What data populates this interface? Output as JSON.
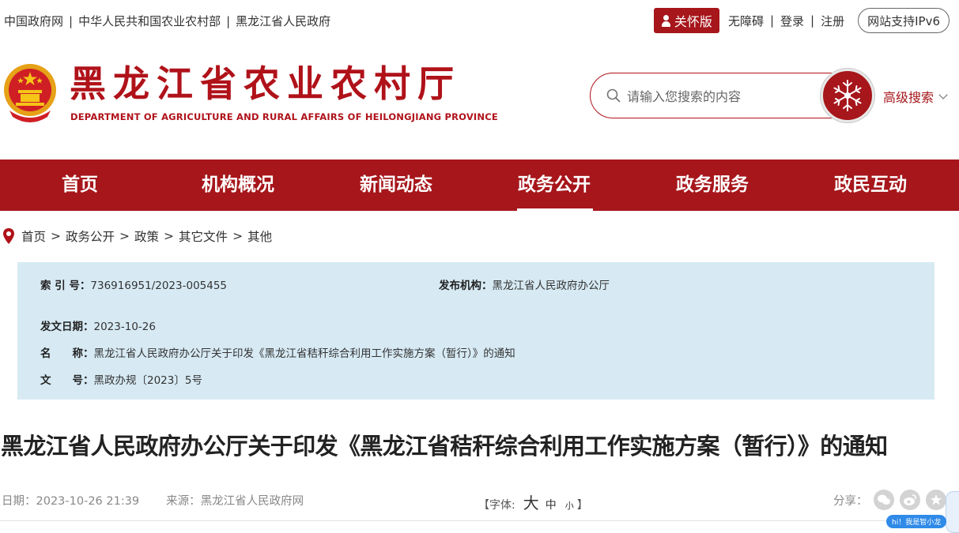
{
  "top_links": [
    "中国政府网",
    "中华人民共和国农业农村部",
    "黑龙江省人民政府"
  ],
  "top_separator": "|",
  "care_mode": "关怀版",
  "accessibility": "无障碍",
  "login": "登录",
  "register": "注册",
  "ipv6": "网站支持IPv6",
  "site": {
    "title": "黑龙江省农业农村厅",
    "subtitle_en": "DEPARTMENT OF AGRICULTURE AND RURAL AFFAIRS OF HEILONGJIANG PROVINCE"
  },
  "search": {
    "placeholder": "请输入您搜索的内容",
    "advanced": "高级搜索"
  },
  "nav": [
    "首页",
    "机构概况",
    "新闻动态",
    "政务公开",
    "政务服务",
    "政民互动"
  ],
  "nav_active": "政务公开",
  "breadcrumb": [
    "首页",
    "政务公开",
    "政策",
    "其它文件",
    "其他"
  ],
  "breadcrumb_sep": ">",
  "info": {
    "index_label": "索 引 号：",
    "index_value": "736916951/2023-005455",
    "org_label": "发布机构：",
    "org_value": "黑龙江省人民政府办公厅",
    "date_label": "发文日期：",
    "date_value": "2023-10-26",
    "name_label": "名　　称：",
    "name_value": "黑龙江省人民政府办公厅关于印发《黑龙江省秸秆综合利用工作实施方案（暂行）》的通知",
    "doc_label": "文　　号：",
    "doc_value": "黑政办规〔2023〕5号"
  },
  "article": {
    "title": "黑龙江省人民政府办公厅关于印发《黑龙江省秸秆综合利用工作实施方案（暂行）》的通知",
    "date": "日期：2023-10-26 21:39",
    "source": "来源：黑龙江省人民政府网",
    "font_label_open": "【字体:",
    "font_big": "大",
    "font_mid": "中",
    "font_small": "小",
    "font_label_close": "】",
    "share_label": "分享："
  },
  "assistant": "hi！我是智小龙",
  "colors": {
    "brand_red": "#a6161b",
    "info_bg": "#d7eaf4"
  },
  "icons": [
    "user-icon",
    "search-icon",
    "snowflake-icon",
    "chevron-down-icon",
    "location-pin-icon",
    "wechat-icon",
    "weibo-icon",
    "star-icon",
    "emblem-icon"
  ]
}
